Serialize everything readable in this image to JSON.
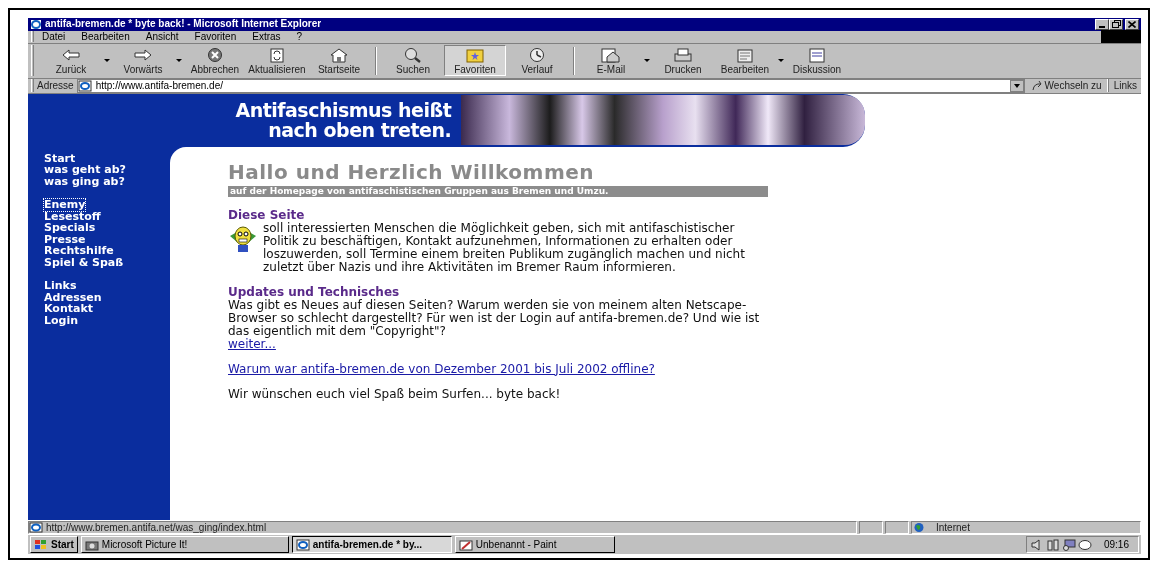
{
  "window": {
    "title": "antifa-bremen.de * byte back! - Microsoft Internet Explorer"
  },
  "menu": [
    "Datei",
    "Bearbeiten",
    "Ansicht",
    "Favoriten",
    "Extras",
    "?"
  ],
  "toolbar": [
    {
      "label": "Zurück",
      "dropdown": true,
      "selected": false
    },
    {
      "label": "Vorwärts",
      "dropdown": true,
      "selected": false
    },
    {
      "label": "Abbrechen",
      "dropdown": false,
      "selected": false
    },
    {
      "label": "Aktualisieren",
      "dropdown": false,
      "selected": false
    },
    {
      "label": "Startseite",
      "dropdown": false,
      "selected": false
    },
    {
      "label": "Suchen",
      "dropdown": false,
      "selected": false
    },
    {
      "label": "Favoriten",
      "dropdown": false,
      "selected": true
    },
    {
      "label": "Verlauf",
      "dropdown": false,
      "selected": false
    },
    {
      "label": "E-Mail",
      "dropdown": true,
      "selected": false
    },
    {
      "label": "Drucken",
      "dropdown": false,
      "selected": false
    },
    {
      "label": "Bearbeiten",
      "dropdown": true,
      "selected": false
    },
    {
      "label": "Diskussion",
      "dropdown": false,
      "selected": false
    }
  ],
  "address": {
    "label": "Adresse",
    "value": "http://www.antifa-bremen.de/",
    "go": "Wechseln zu",
    "links": "Links"
  },
  "banner": {
    "lines": [
      "Antifaschismus heißt",
      "nach oben treten."
    ]
  },
  "sidebar": {
    "groups": [
      {
        "items": [
          {
            "label": "Start",
            "selected": false
          },
          {
            "label": "was geht ab?",
            "selected": false
          },
          {
            "label": "was ging ab?",
            "selected": false
          }
        ]
      },
      {
        "items": [
          {
            "label": "Enemy",
            "selected": true
          },
          {
            "label": "Lesestoff",
            "selected": false
          },
          {
            "label": "Specials",
            "selected": false
          },
          {
            "label": "Presse",
            "selected": false
          },
          {
            "label": "Rechtshilfe",
            "selected": false
          },
          {
            "label": "Spiel & Spaß",
            "selected": false
          }
        ]
      },
      {
        "items": [
          {
            "label": "Links",
            "selected": false
          },
          {
            "label": "Adressen",
            "selected": false
          },
          {
            "label": "Kontakt",
            "selected": false
          },
          {
            "label": "Login",
            "selected": false
          }
        ]
      }
    ]
  },
  "content": {
    "heading": "Hallo und Herzlich Willkommen",
    "subheading": "auf der Homepage von antifaschistischen Gruppen aus Bremen und Umzu.",
    "blocks": [
      {
        "kind": "section",
        "title": "Diese Seite",
        "text": "soll interessierten Menschen die Möglichkeit geben, sich mit antifaschistischer Politik zu beschäftigen, Kontakt aufzunehmen, Informationen zu erhalten oder loszuwerden, soll Termine einem breiten Publikum zugänglich machen und nicht zuletzt über Nazis und ihre Aktivitäten im Bremer Raum informieren.",
        "mascot": true
      },
      {
        "kind": "section",
        "title": "Updates und Technisches",
        "text": "Was gibt es Neues auf diesen Seiten? Warum werden sie von meinem alten Netscape-Browser so schlecht dargestellt? Für wen ist der Login auf antifa-bremen.de? Und wie ist das eigentlich mit dem \"Copyright\"?",
        "link": "weiter..."
      },
      {
        "kind": "link",
        "text": "Warum war antifa-bremen.de von Dezember 2001 bis Juli 2002 offline?"
      },
      {
        "kind": "text",
        "text": "Wir wünschen euch viel Spaß beim Surfen... byte back!"
      }
    ]
  },
  "status_bar": {
    "url": "http://www.bremen.antifa.net/was_ging/index.html",
    "zone": "Internet"
  },
  "taskbar": {
    "start": "Start",
    "tasks": [
      {
        "label": "Microsoft Picture It!",
        "selected": false
      },
      {
        "label": "antifa-bremen.de * by...",
        "selected": true
      },
      {
        "label": "Unbenannt - Paint",
        "selected": false
      }
    ],
    "time": "09:16"
  }
}
